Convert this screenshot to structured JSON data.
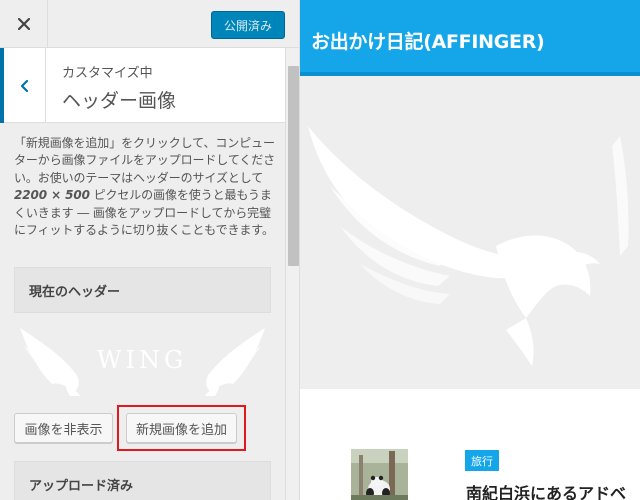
{
  "topbar": {
    "close_icon": "close-icon",
    "publish_label": "公開済み",
    "publish_color": "#0085ba"
  },
  "section": {
    "breadcrumb": "カスタマイズ中",
    "title": "ヘッダー画像",
    "back_icon": "chevron-left-icon",
    "accent_color": "#0073aa"
  },
  "help": {
    "before": "「新規画像を追加」をクリックして、コンピューターから画像ファイルをアップロードしてください。お使いのテーマはヘッダーのサイズとして ",
    "size": "2200 × 500",
    "after": " ピクセルの画像を使うと最もうまくいきます ― 画像をアップロードしてから完璧にフィットするように切り抜くこともできます。"
  },
  "current_header": {
    "label": "現在のヘッダー",
    "thumbnail_text": "WING"
  },
  "buttons": {
    "hide_image": "画像を非表示",
    "add_new_image": "新規画像を追加",
    "highlight_color": "#e0191d"
  },
  "uploaded": {
    "label": "アップロード済み"
  },
  "preview": {
    "site_title": "お出かけ日記(AFFINGER)",
    "header_color": "#14a6e9",
    "post": {
      "category": "旅行",
      "title": "南紀白浜にあるアドベ"
    }
  }
}
